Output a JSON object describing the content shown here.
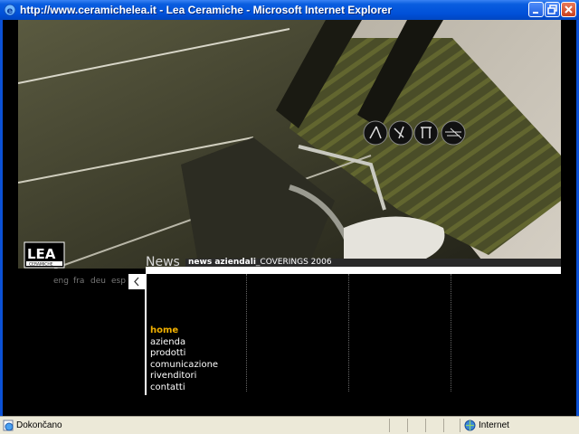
{
  "window": {
    "title": "http://www.ceramichelea.it - Lea Ceramiche - Microsoft Internet Explorer"
  },
  "page": {
    "logo": {
      "text": "LEA",
      "subtext": "CERAMICHE"
    },
    "languages": [
      "eng",
      "fra",
      "deu",
      "esp"
    ],
    "news": {
      "heading": "News",
      "label": "news aziendali",
      "text": "_COVERINGS 2006"
    },
    "menu": [
      {
        "label": "home",
        "active": true
      },
      {
        "label": "azienda",
        "active": false
      },
      {
        "label": "prodotti",
        "active": false
      },
      {
        "label": "comunicazione",
        "active": false
      },
      {
        "label": "rivenditori",
        "active": false
      },
      {
        "label": "contatti",
        "active": false
      }
    ],
    "colors": {
      "accent": "#f0b000",
      "background": "#000000"
    }
  },
  "statusbar": {
    "status": "Dokončano",
    "zone": "Internet"
  },
  "icons": [
    "ie-icon",
    "minimize-icon",
    "restore-icon",
    "close-icon",
    "back-arrow-icon",
    "globe-icon",
    "page-done-icon"
  ]
}
